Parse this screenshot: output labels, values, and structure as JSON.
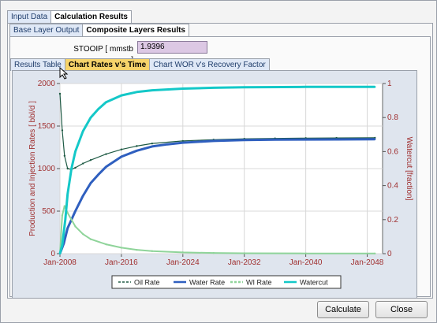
{
  "tabs_main": [
    {
      "label": "Input Data"
    },
    {
      "label": "Calculation Results"
    }
  ],
  "tabs_sub": [
    {
      "label": "Base Layer Output"
    },
    {
      "label": "Composite Layers Results"
    }
  ],
  "tabs_chart": [
    {
      "label": "Results Table"
    },
    {
      "label": "Chart Rates v's Time"
    },
    {
      "label": "Chart WOR v's Recovery Factor"
    }
  ],
  "stooip": {
    "label": "STOOIP [ mmstb ]",
    "value": "1.9396"
  },
  "buttons": {
    "calculate": "Calculate",
    "close": "Close"
  },
  "colors": {
    "oil": "#1e5a44",
    "water": "#2f5fbf",
    "wi": "#8fd49a",
    "watercut": "#14c8c8",
    "axis_label": "#a03030"
  },
  "chart_data": {
    "type": "line",
    "ylabel": "Production and Injection Rates [ bbl/d ]",
    "y2label": "Watercut [fraction]",
    "x_ticks": [
      "Jan-2008",
      "Jan-2016",
      "Jan-2024",
      "Jan-2032",
      "Jan-2040",
      "Jan-2048"
    ],
    "xlim": [
      2008,
      2050
    ],
    "ylim": [
      0,
      2000
    ],
    "y_ticks": [
      "0",
      "500",
      "1000",
      "1500",
      "2000"
    ],
    "y2lim": [
      0,
      1
    ],
    "y2_ticks": [
      "0",
      "0.2",
      "0.4",
      "0.6",
      "0.8",
      "1"
    ],
    "grid": true,
    "legend_position": "bottom",
    "series": [
      {
        "name": "Oil Rate",
        "axis": "left",
        "x": [
          2008,
          2008.3,
          2008.6,
          2009,
          2009.5,
          2010,
          2011,
          2012,
          2014,
          2016,
          2018,
          2020,
          2024,
          2028,
          2032,
          2036,
          2040,
          2044,
          2049
        ],
        "y": [
          1880,
          1450,
          1150,
          1000,
          990,
          1010,
          1060,
          1100,
          1170,
          1225,
          1265,
          1295,
          1325,
          1340,
          1350,
          1355,
          1358,
          1360,
          1362
        ]
      },
      {
        "name": "Water Rate",
        "axis": "left",
        "x": [
          2008,
          2008.5,
          2009,
          2010,
          2011,
          2012,
          2013,
          2014,
          2016,
          2018,
          2020,
          2022,
          2024,
          2028,
          2032,
          2036,
          2040,
          2044,
          2049
        ],
        "y": [
          0,
          120,
          300,
          500,
          680,
          830,
          930,
          1020,
          1140,
          1210,
          1260,
          1285,
          1305,
          1325,
          1335,
          1340,
          1342,
          1343,
          1345
        ]
      },
      {
        "name": "WI Rate",
        "axis": "left",
        "x": [
          2008,
          2008.3,
          2008.6,
          2009,
          2010,
          2011,
          2012,
          2014,
          2016,
          2018,
          2020,
          2024,
          2028,
          2032,
          2040,
          2049
        ],
        "y": [
          0,
          450,
          560,
          480,
          320,
          230,
          170,
          110,
          70,
          45,
          30,
          15,
          8,
          5,
          3,
          2
        ]
      },
      {
        "name": "Watercut",
        "axis": "right",
        "x": [
          2008,
          2008.3,
          2008.7,
          2009,
          2009.5,
          2010,
          2011,
          2012,
          2013,
          2014,
          2016,
          2018,
          2020,
          2024,
          2028,
          2032,
          2040,
          2049
        ],
        "y": [
          0,
          0.05,
          0.2,
          0.35,
          0.5,
          0.6,
          0.72,
          0.8,
          0.85,
          0.89,
          0.93,
          0.95,
          0.96,
          0.97,
          0.975,
          0.978,
          0.98,
          0.98
        ]
      }
    ]
  }
}
